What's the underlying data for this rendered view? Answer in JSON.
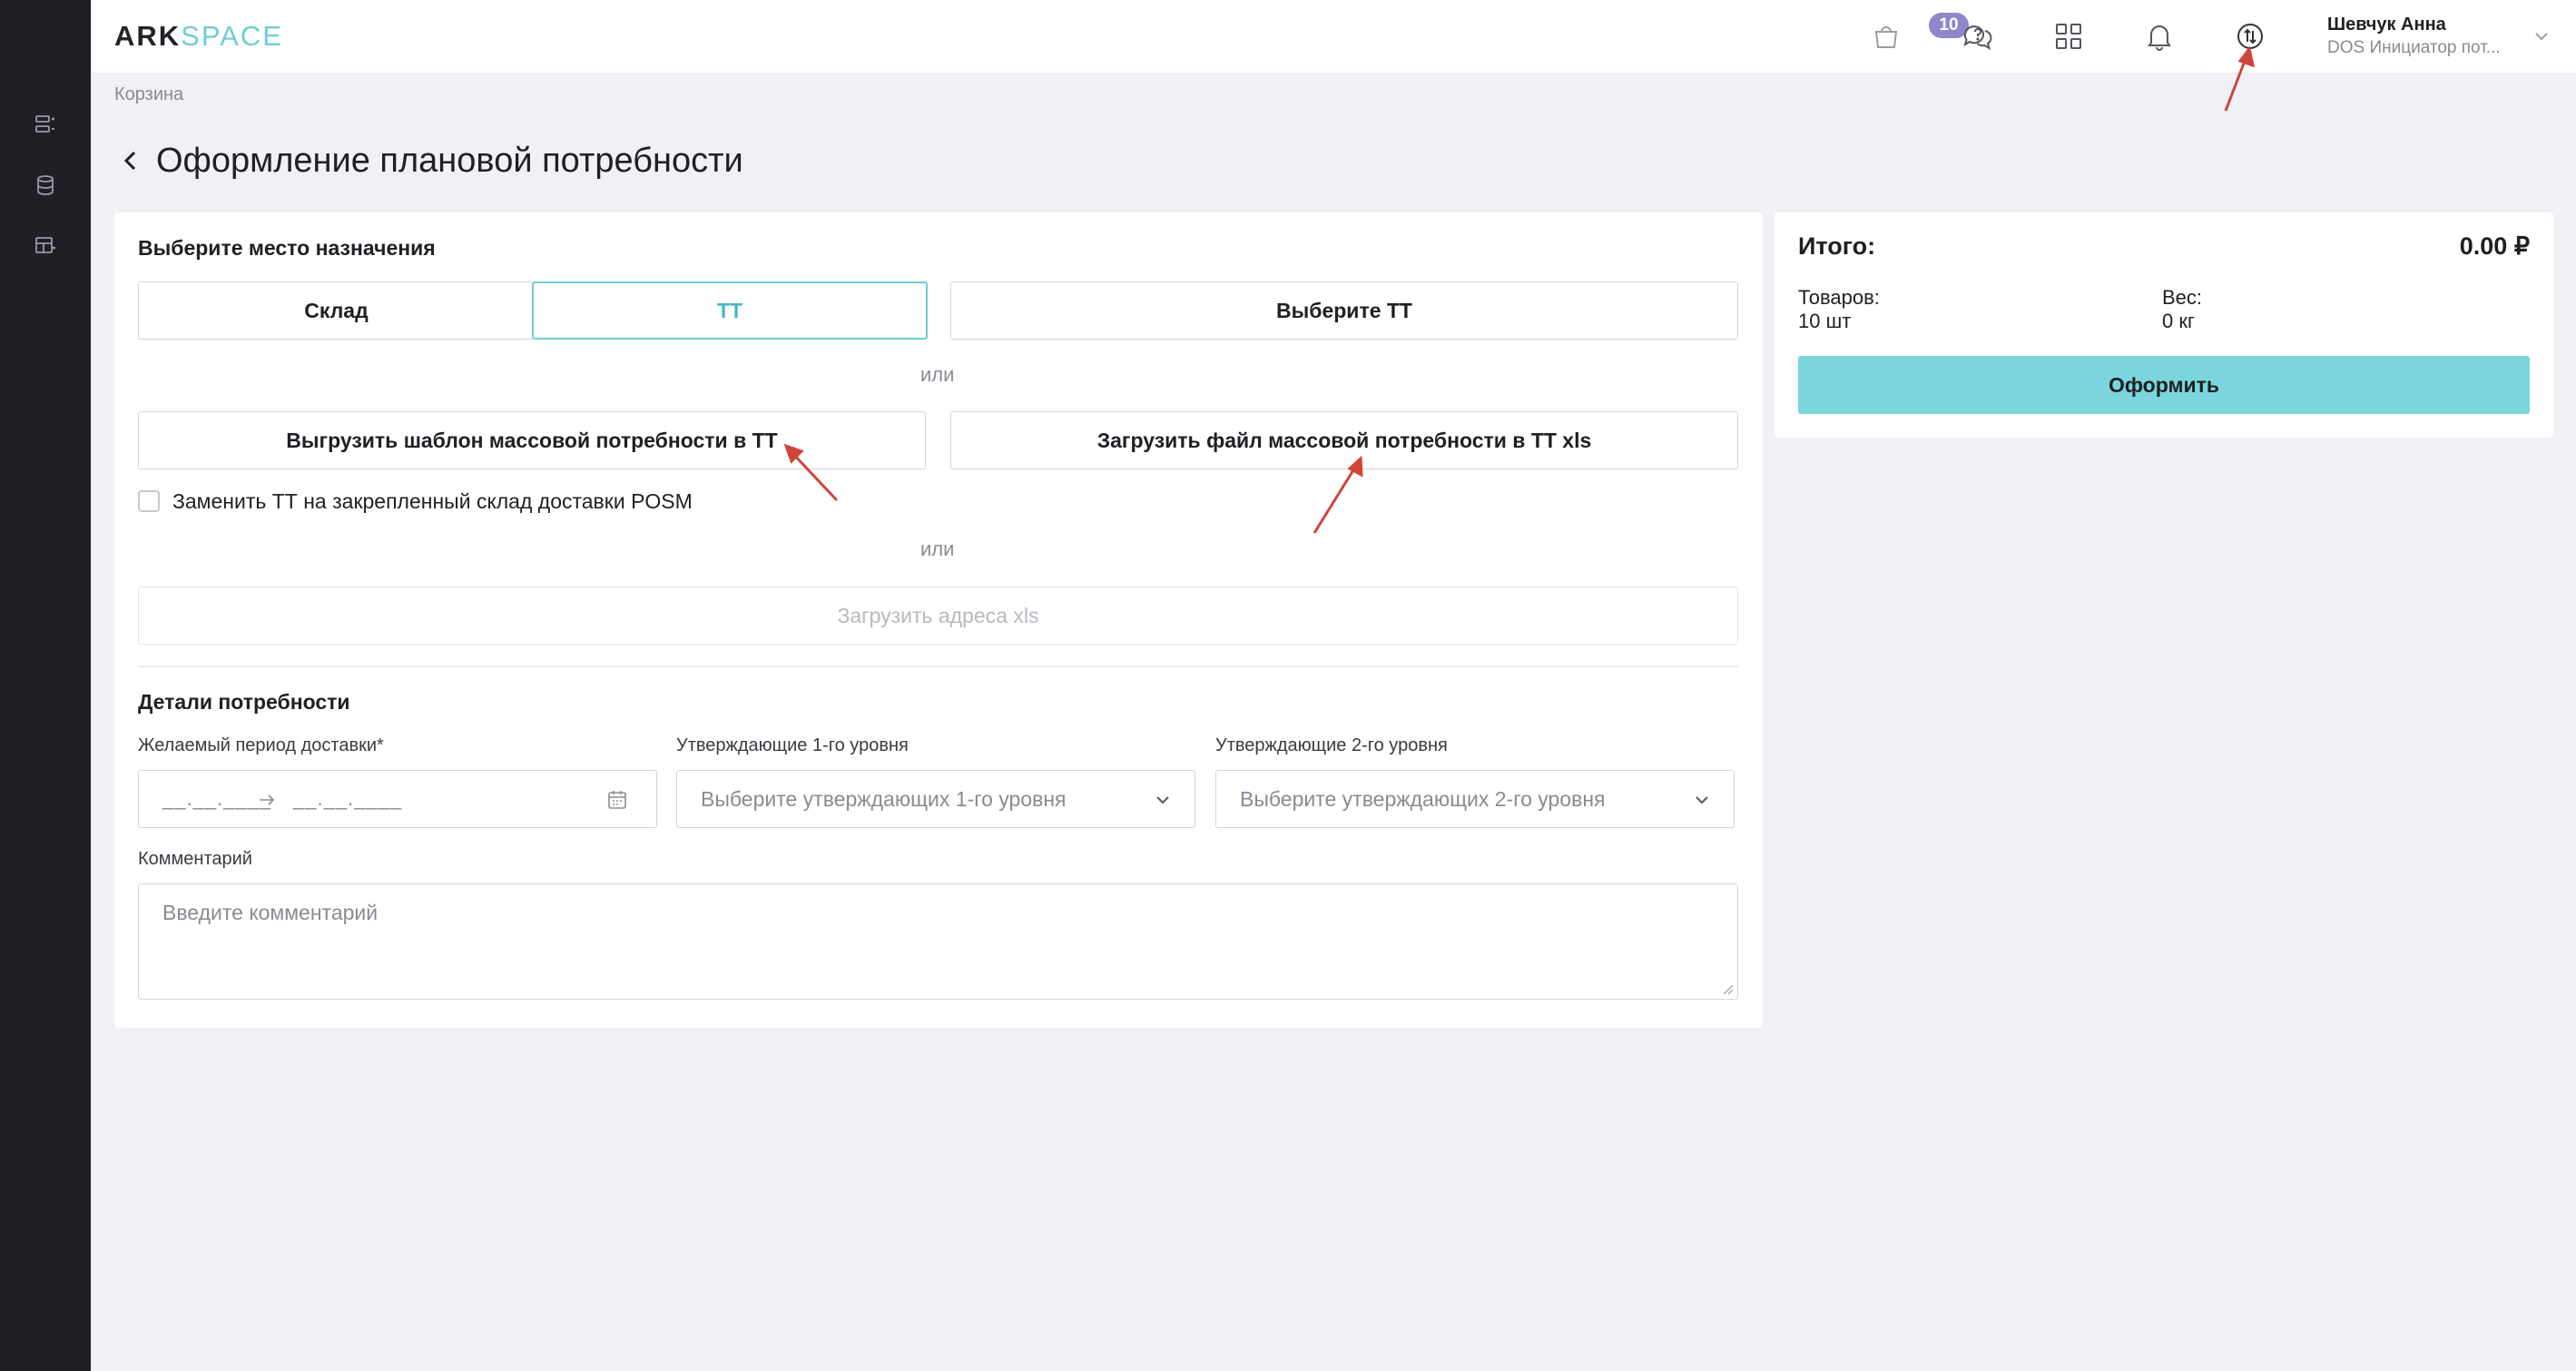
{
  "app": {
    "logo_part1": "ARK",
    "logo_part2": "SPACE"
  },
  "header": {
    "cart_badge": "10",
    "icons": [
      "cart-icon",
      "support-chat-icon",
      "apps-grid-icon",
      "bell-icon",
      "sync-icon"
    ],
    "user_name": "Шевчук Анна",
    "user_role": "DOS Инициатор пот..."
  },
  "sidebar": {
    "icons": [
      "list-icon",
      "database-icon",
      "table-icon"
    ]
  },
  "breadcrumb": "Корзина",
  "page_title": "Оформление плановой потребности",
  "destination": {
    "label": "Выберите место назначения",
    "tab_warehouse": "Склад",
    "tab_tt": "ТТ",
    "select_tt": "Выберите ТТ",
    "or_1": "или",
    "export_template": "Выгрузить шаблон массовой потребности в ТТ",
    "upload_file": "Загрузить файл массовой потребности в ТТ xls",
    "replace_checkbox": "Заменить ТТ на закрепленный склад доставки POSM",
    "or_2": "или",
    "upload_addresses": "Загрузить адреса xls"
  },
  "details": {
    "label": "Детали потребности",
    "period_label": "Желаемый период доставки*",
    "date_from": "__.__.____",
    "date_to": "__.__.____",
    "approvers1_label": "Утверждающие 1-го уровня",
    "approvers1_placeholder": "Выберите утверждающих 1-го уровня",
    "approvers2_label": "Утверждающие 2-го уровня",
    "approvers2_placeholder": "Выберите утверждающих 2-го уровня",
    "comment_label": "Комментарий",
    "comment_placeholder": "Введите комментарий"
  },
  "summary": {
    "title": "Итого:",
    "total": "0.00 ₽",
    "items_label": "Товаров:",
    "items_value": "10 шт",
    "weight_label": "Вес:",
    "weight_value": "0 кг",
    "submit": "Оформить"
  },
  "colors": {
    "accent": "#6fcdd5",
    "primary_button": "#7ad6dc",
    "badge": "#8e87c9",
    "annotation_arrow": "#d0453a",
    "sidebar_bg": "#1f1f26"
  }
}
